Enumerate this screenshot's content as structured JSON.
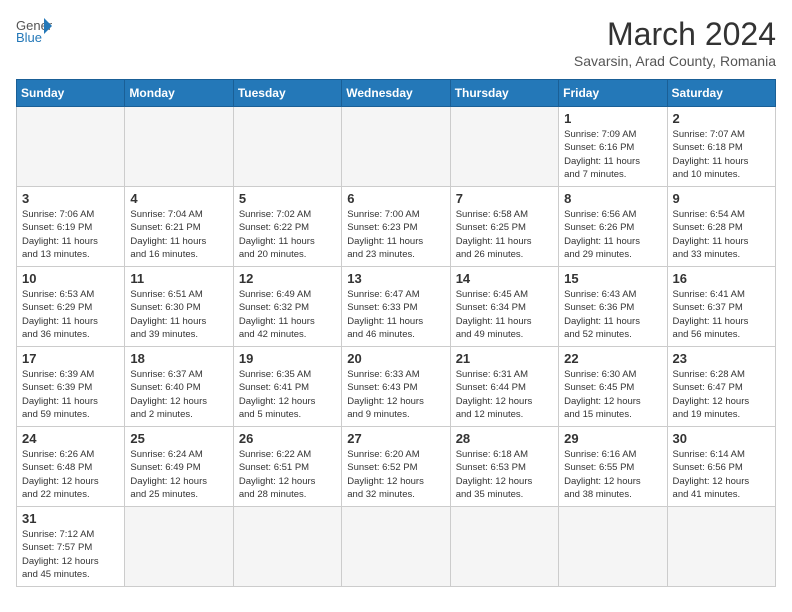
{
  "header": {
    "logo_general": "General",
    "logo_blue": "Blue",
    "month_title": "March 2024",
    "subtitle": "Savarsin, Arad County, Romania"
  },
  "weekdays": [
    "Sunday",
    "Monday",
    "Tuesday",
    "Wednesday",
    "Thursday",
    "Friday",
    "Saturday"
  ],
  "weeks": [
    [
      {
        "day": "",
        "info": "",
        "empty": true
      },
      {
        "day": "",
        "info": "",
        "empty": true
      },
      {
        "day": "",
        "info": "",
        "empty": true
      },
      {
        "day": "",
        "info": "",
        "empty": true
      },
      {
        "day": "",
        "info": "",
        "empty": true
      },
      {
        "day": "1",
        "info": "Sunrise: 7:09 AM\nSunset: 6:16 PM\nDaylight: 11 hours\nand 7 minutes."
      },
      {
        "day": "2",
        "info": "Sunrise: 7:07 AM\nSunset: 6:18 PM\nDaylight: 11 hours\nand 10 minutes."
      }
    ],
    [
      {
        "day": "3",
        "info": "Sunrise: 7:06 AM\nSunset: 6:19 PM\nDaylight: 11 hours\nand 13 minutes."
      },
      {
        "day": "4",
        "info": "Sunrise: 7:04 AM\nSunset: 6:21 PM\nDaylight: 11 hours\nand 16 minutes."
      },
      {
        "day": "5",
        "info": "Sunrise: 7:02 AM\nSunset: 6:22 PM\nDaylight: 11 hours\nand 20 minutes."
      },
      {
        "day": "6",
        "info": "Sunrise: 7:00 AM\nSunset: 6:23 PM\nDaylight: 11 hours\nand 23 minutes."
      },
      {
        "day": "7",
        "info": "Sunrise: 6:58 AM\nSunset: 6:25 PM\nDaylight: 11 hours\nand 26 minutes."
      },
      {
        "day": "8",
        "info": "Sunrise: 6:56 AM\nSunset: 6:26 PM\nDaylight: 11 hours\nand 29 minutes."
      },
      {
        "day": "9",
        "info": "Sunrise: 6:54 AM\nSunset: 6:28 PM\nDaylight: 11 hours\nand 33 minutes."
      }
    ],
    [
      {
        "day": "10",
        "info": "Sunrise: 6:53 AM\nSunset: 6:29 PM\nDaylight: 11 hours\nand 36 minutes."
      },
      {
        "day": "11",
        "info": "Sunrise: 6:51 AM\nSunset: 6:30 PM\nDaylight: 11 hours\nand 39 minutes."
      },
      {
        "day": "12",
        "info": "Sunrise: 6:49 AM\nSunset: 6:32 PM\nDaylight: 11 hours\nand 42 minutes."
      },
      {
        "day": "13",
        "info": "Sunrise: 6:47 AM\nSunset: 6:33 PM\nDaylight: 11 hours\nand 46 minutes."
      },
      {
        "day": "14",
        "info": "Sunrise: 6:45 AM\nSunset: 6:34 PM\nDaylight: 11 hours\nand 49 minutes."
      },
      {
        "day": "15",
        "info": "Sunrise: 6:43 AM\nSunset: 6:36 PM\nDaylight: 11 hours\nand 52 minutes."
      },
      {
        "day": "16",
        "info": "Sunrise: 6:41 AM\nSunset: 6:37 PM\nDaylight: 11 hours\nand 56 minutes."
      }
    ],
    [
      {
        "day": "17",
        "info": "Sunrise: 6:39 AM\nSunset: 6:39 PM\nDaylight: 11 hours\nand 59 minutes."
      },
      {
        "day": "18",
        "info": "Sunrise: 6:37 AM\nSunset: 6:40 PM\nDaylight: 12 hours\nand 2 minutes."
      },
      {
        "day": "19",
        "info": "Sunrise: 6:35 AM\nSunset: 6:41 PM\nDaylight: 12 hours\nand 5 minutes."
      },
      {
        "day": "20",
        "info": "Sunrise: 6:33 AM\nSunset: 6:43 PM\nDaylight: 12 hours\nand 9 minutes."
      },
      {
        "day": "21",
        "info": "Sunrise: 6:31 AM\nSunset: 6:44 PM\nDaylight: 12 hours\nand 12 minutes."
      },
      {
        "day": "22",
        "info": "Sunrise: 6:30 AM\nSunset: 6:45 PM\nDaylight: 12 hours\nand 15 minutes."
      },
      {
        "day": "23",
        "info": "Sunrise: 6:28 AM\nSunset: 6:47 PM\nDaylight: 12 hours\nand 19 minutes."
      }
    ],
    [
      {
        "day": "24",
        "info": "Sunrise: 6:26 AM\nSunset: 6:48 PM\nDaylight: 12 hours\nand 22 minutes."
      },
      {
        "day": "25",
        "info": "Sunrise: 6:24 AM\nSunset: 6:49 PM\nDaylight: 12 hours\nand 25 minutes."
      },
      {
        "day": "26",
        "info": "Sunrise: 6:22 AM\nSunset: 6:51 PM\nDaylight: 12 hours\nand 28 minutes."
      },
      {
        "day": "27",
        "info": "Sunrise: 6:20 AM\nSunset: 6:52 PM\nDaylight: 12 hours\nand 32 minutes."
      },
      {
        "day": "28",
        "info": "Sunrise: 6:18 AM\nSunset: 6:53 PM\nDaylight: 12 hours\nand 35 minutes."
      },
      {
        "day": "29",
        "info": "Sunrise: 6:16 AM\nSunset: 6:55 PM\nDaylight: 12 hours\nand 38 minutes."
      },
      {
        "day": "30",
        "info": "Sunrise: 6:14 AM\nSunset: 6:56 PM\nDaylight: 12 hours\nand 41 minutes."
      }
    ],
    [
      {
        "day": "31",
        "info": "Sunrise: 7:12 AM\nSunset: 7:57 PM\nDaylight: 12 hours\nand 45 minutes.",
        "last": true
      },
      {
        "day": "",
        "info": "",
        "empty": true,
        "last": true
      },
      {
        "day": "",
        "info": "",
        "empty": true,
        "last": true
      },
      {
        "day": "",
        "info": "",
        "empty": true,
        "last": true
      },
      {
        "day": "",
        "info": "",
        "empty": true,
        "last": true
      },
      {
        "day": "",
        "info": "",
        "empty": true,
        "last": true
      },
      {
        "day": "",
        "info": "",
        "empty": true,
        "last": true
      }
    ]
  ]
}
